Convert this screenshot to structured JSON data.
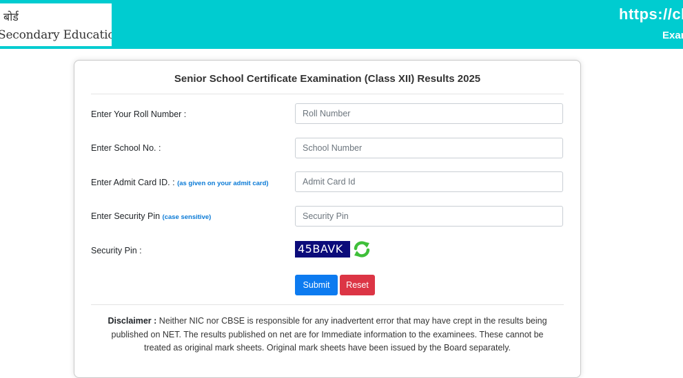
{
  "header": {
    "logo_hindi": "बोर्ड",
    "logo_english": "Secondary Education",
    "url_text": "https://cb",
    "sub_text": "Exar",
    "background_color": "#00ccd0"
  },
  "form": {
    "title": "Senior School Certificate Examination (Class XII) Results 2025",
    "roll": {
      "label": "Enter Your Roll Number :",
      "placeholder": "Roll Number",
      "value": ""
    },
    "school": {
      "label": "Enter School No. :",
      "placeholder": "School Number",
      "value": ""
    },
    "admit": {
      "label": "Enter Admit Card ID. :",
      "hint": "(as given on your admit card)",
      "placeholder": "Admit Card Id",
      "value": ""
    },
    "pin": {
      "label": "Enter Security Pin",
      "hint": "(case sensitive)",
      "placeholder": "Security Pin",
      "value": ""
    },
    "captcha": {
      "label": "Security Pin :",
      "code": "45BAVK",
      "refresh_icon": "refresh-icon"
    },
    "buttons": {
      "submit": "Submit",
      "reset": "Reset"
    },
    "colors": {
      "submit": "#0d7bf0",
      "reset": "#dc3545",
      "hint": "#0a7ad6",
      "captcha_bg": "#0b0b7a"
    }
  },
  "disclaimer": {
    "label": "Disclaimer :",
    "text": " Neither NIC nor CBSE is responsible for any inadvertent error that may have crept in the results being published on NET. The results published on net are for Immediate information to the examinees. These cannot be treated as original mark sheets. Original mark sheets have been issued by the Board separately."
  }
}
